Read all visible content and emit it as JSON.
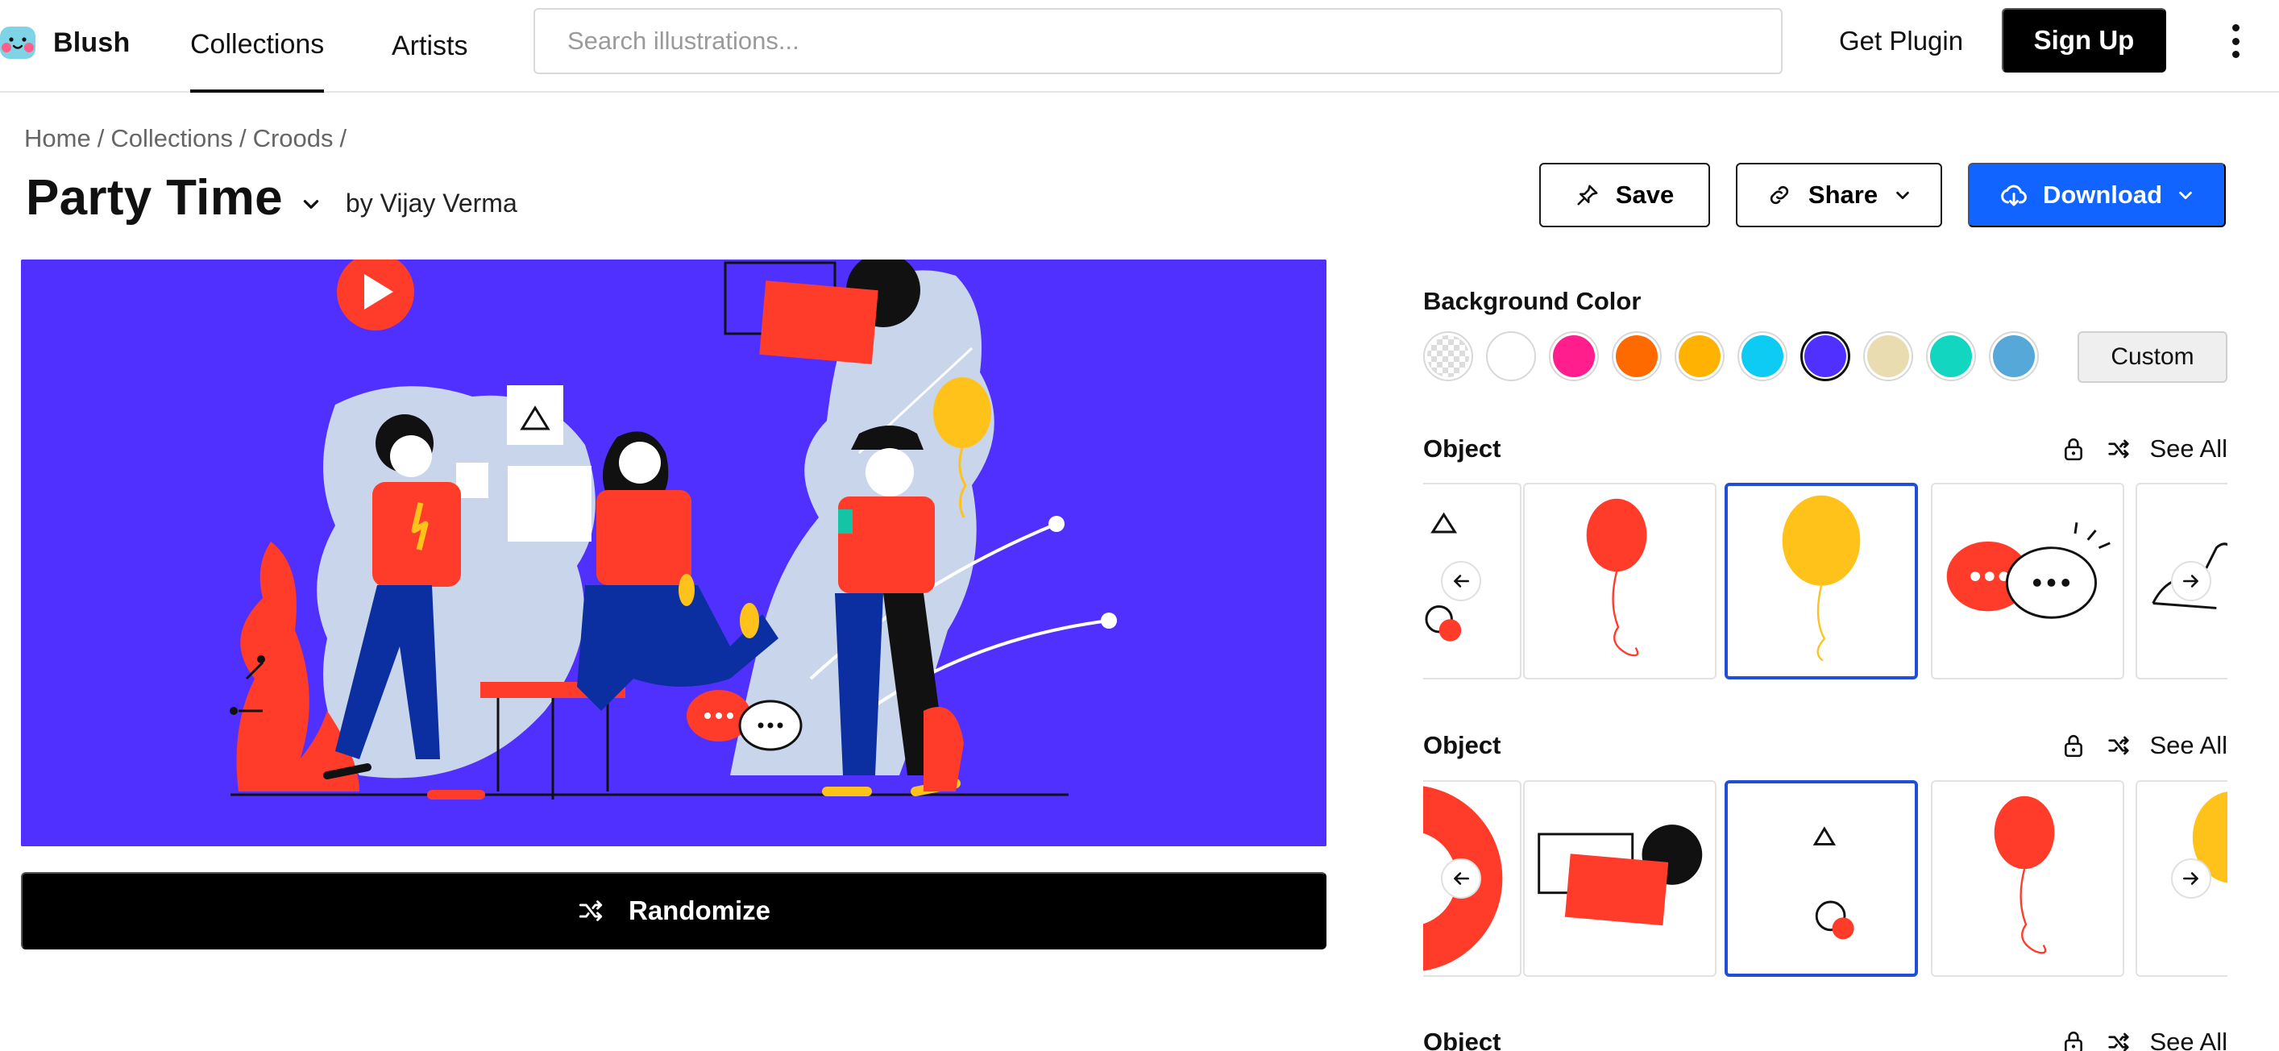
{
  "app": {
    "name": "Blush"
  },
  "nav": {
    "items": [
      {
        "label": "Collections",
        "active": true
      },
      {
        "label": "Artists",
        "active": false
      }
    ],
    "search_placeholder": "Search illustrations...",
    "get_plugin": "Get Plugin",
    "sign_up": "Sign Up"
  },
  "breadcrumb": [
    {
      "label": "Home"
    },
    {
      "label": "Collections"
    },
    {
      "label": "Croods"
    }
  ],
  "title": "Party Time",
  "byline": "by Vijay Verma",
  "actions": {
    "save": "Save",
    "share": "Share",
    "download": "Download"
  },
  "randomize": "Randomize",
  "background": {
    "heading": "Background Color",
    "custom": "Custom",
    "swatches": [
      {
        "name": "transparent",
        "color": "transparent",
        "selected": false
      },
      {
        "name": "white",
        "color": "#ffffff",
        "selected": false
      },
      {
        "name": "pink",
        "color": "#ff1e8c",
        "selected": false
      },
      {
        "name": "orange",
        "color": "#ff6a00",
        "selected": false
      },
      {
        "name": "amber",
        "color": "#ffb300",
        "selected": false
      },
      {
        "name": "cyan",
        "color": "#0dcbf2",
        "selected": false
      },
      {
        "name": "violet",
        "color": "#5030ff",
        "selected": true
      },
      {
        "name": "sand",
        "color": "#e8dcb0",
        "selected": false
      },
      {
        "name": "teal",
        "color": "#12d6c0",
        "selected": false
      },
      {
        "name": "sky",
        "color": "#55a8d8",
        "selected": false
      }
    ]
  },
  "sections": [
    {
      "label": "Object",
      "see_all": "See All"
    },
    {
      "label": "Object",
      "see_all": "See All"
    },
    {
      "label": "Object",
      "see_all": "See All"
    }
  ],
  "colors": {
    "accent": "#1164ff",
    "illustration_bg": "#5030ff",
    "selected_border": "#1e4fd6",
    "character_red": "#ff3b2a",
    "character_blue": "#0b2fa0"
  }
}
